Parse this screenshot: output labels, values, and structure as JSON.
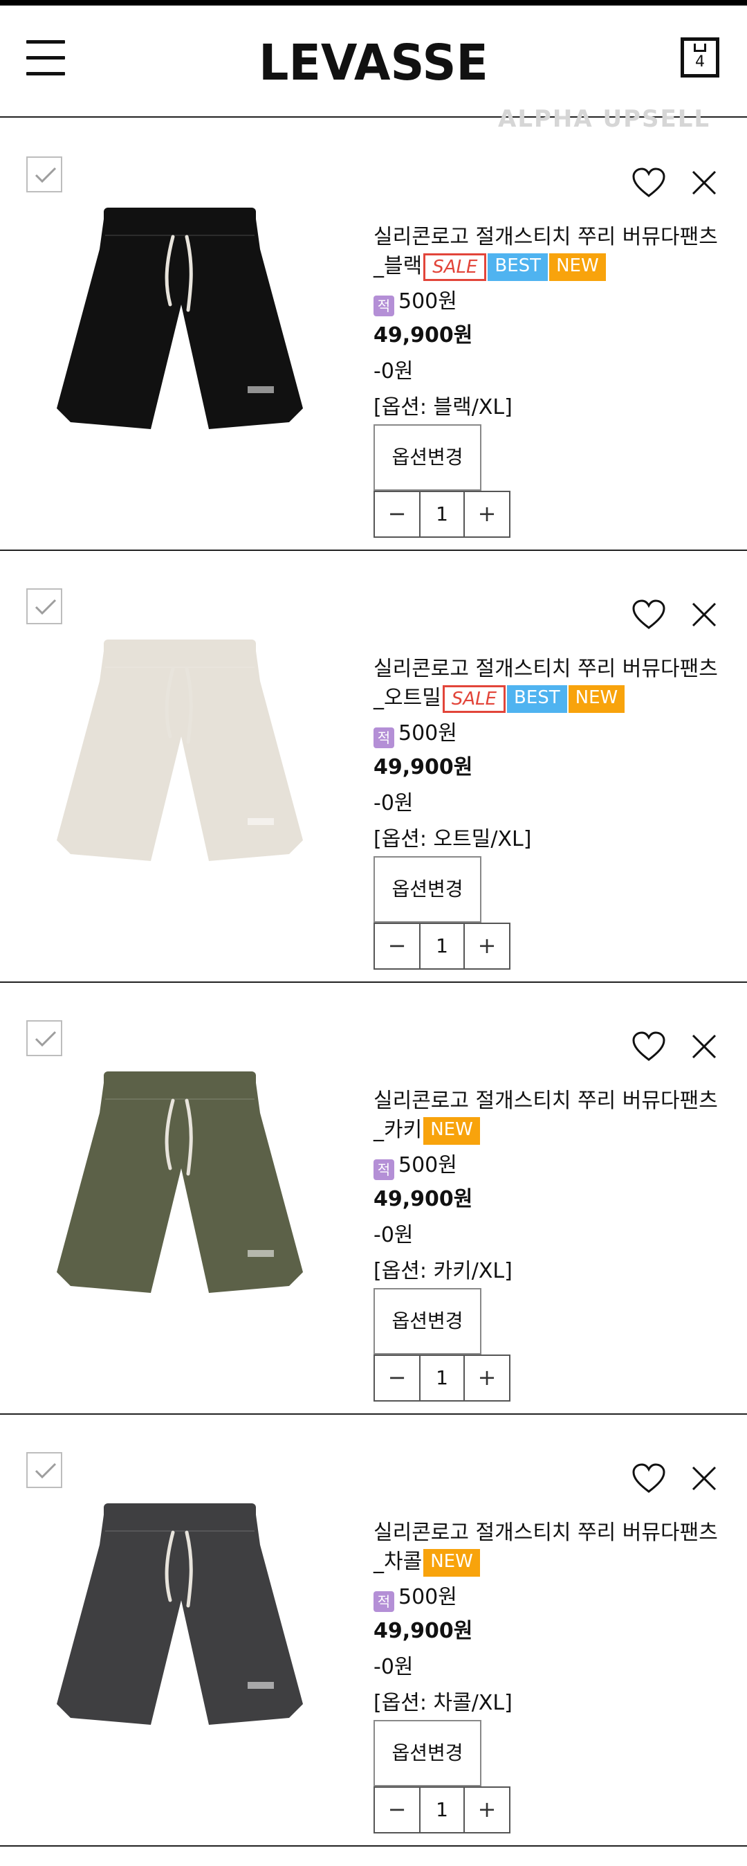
{
  "header": {
    "logo": "LEVASSE",
    "cart_count": "4",
    "watermark": "ALPHA UPSELL"
  },
  "colors": {
    "sale": "#e2453a",
    "best": "#4fb3f0",
    "new": "#f8a30c",
    "point": "#b48fd6"
  },
  "items": [
    {
      "name": "실리콘로고 절개스티치 쭈리 버뮤다팬츠_블랙",
      "badges": [
        "SALE",
        "BEST",
        "NEW"
      ],
      "point_icon": "적",
      "points": "500원",
      "price": "49,900원",
      "discount": "-0원",
      "option": "[옵션: 블랙/XL]",
      "option_button": "옵션변경",
      "quantity": "1",
      "product_color": "#111111"
    },
    {
      "name": "실리콘로고 절개스티치 쭈리 버뮤다팬츠_오트밀",
      "badges": [
        "SALE",
        "BEST",
        "NEW"
      ],
      "point_icon": "적",
      "points": "500원",
      "price": "49,900원",
      "discount": "-0원",
      "option": "[옵션: 오트밀/XL]",
      "option_button": "옵션변경",
      "quantity": "1",
      "product_color": "#e6e1d8"
    },
    {
      "name": "실리콘로고 절개스티치 쭈리 버뮤다팬츠_카키",
      "badges": [
        "NEW"
      ],
      "point_icon": "적",
      "points": "500원",
      "price": "49,900원",
      "discount": "-0원",
      "option": "[옵션: 카키/XL]",
      "option_button": "옵션변경",
      "quantity": "1",
      "product_color": "#5c6148"
    },
    {
      "name": "실리콘로고 절개스티치 쭈리 버뮤다팬츠_차콜",
      "badges": [
        "NEW"
      ],
      "point_icon": "적",
      "points": "500원",
      "price": "49,900원",
      "discount": "-0원",
      "option": "[옵션: 차콜/XL]",
      "option_button": "옵션변경",
      "quantity": "1",
      "product_color": "#3f3f41"
    }
  ]
}
